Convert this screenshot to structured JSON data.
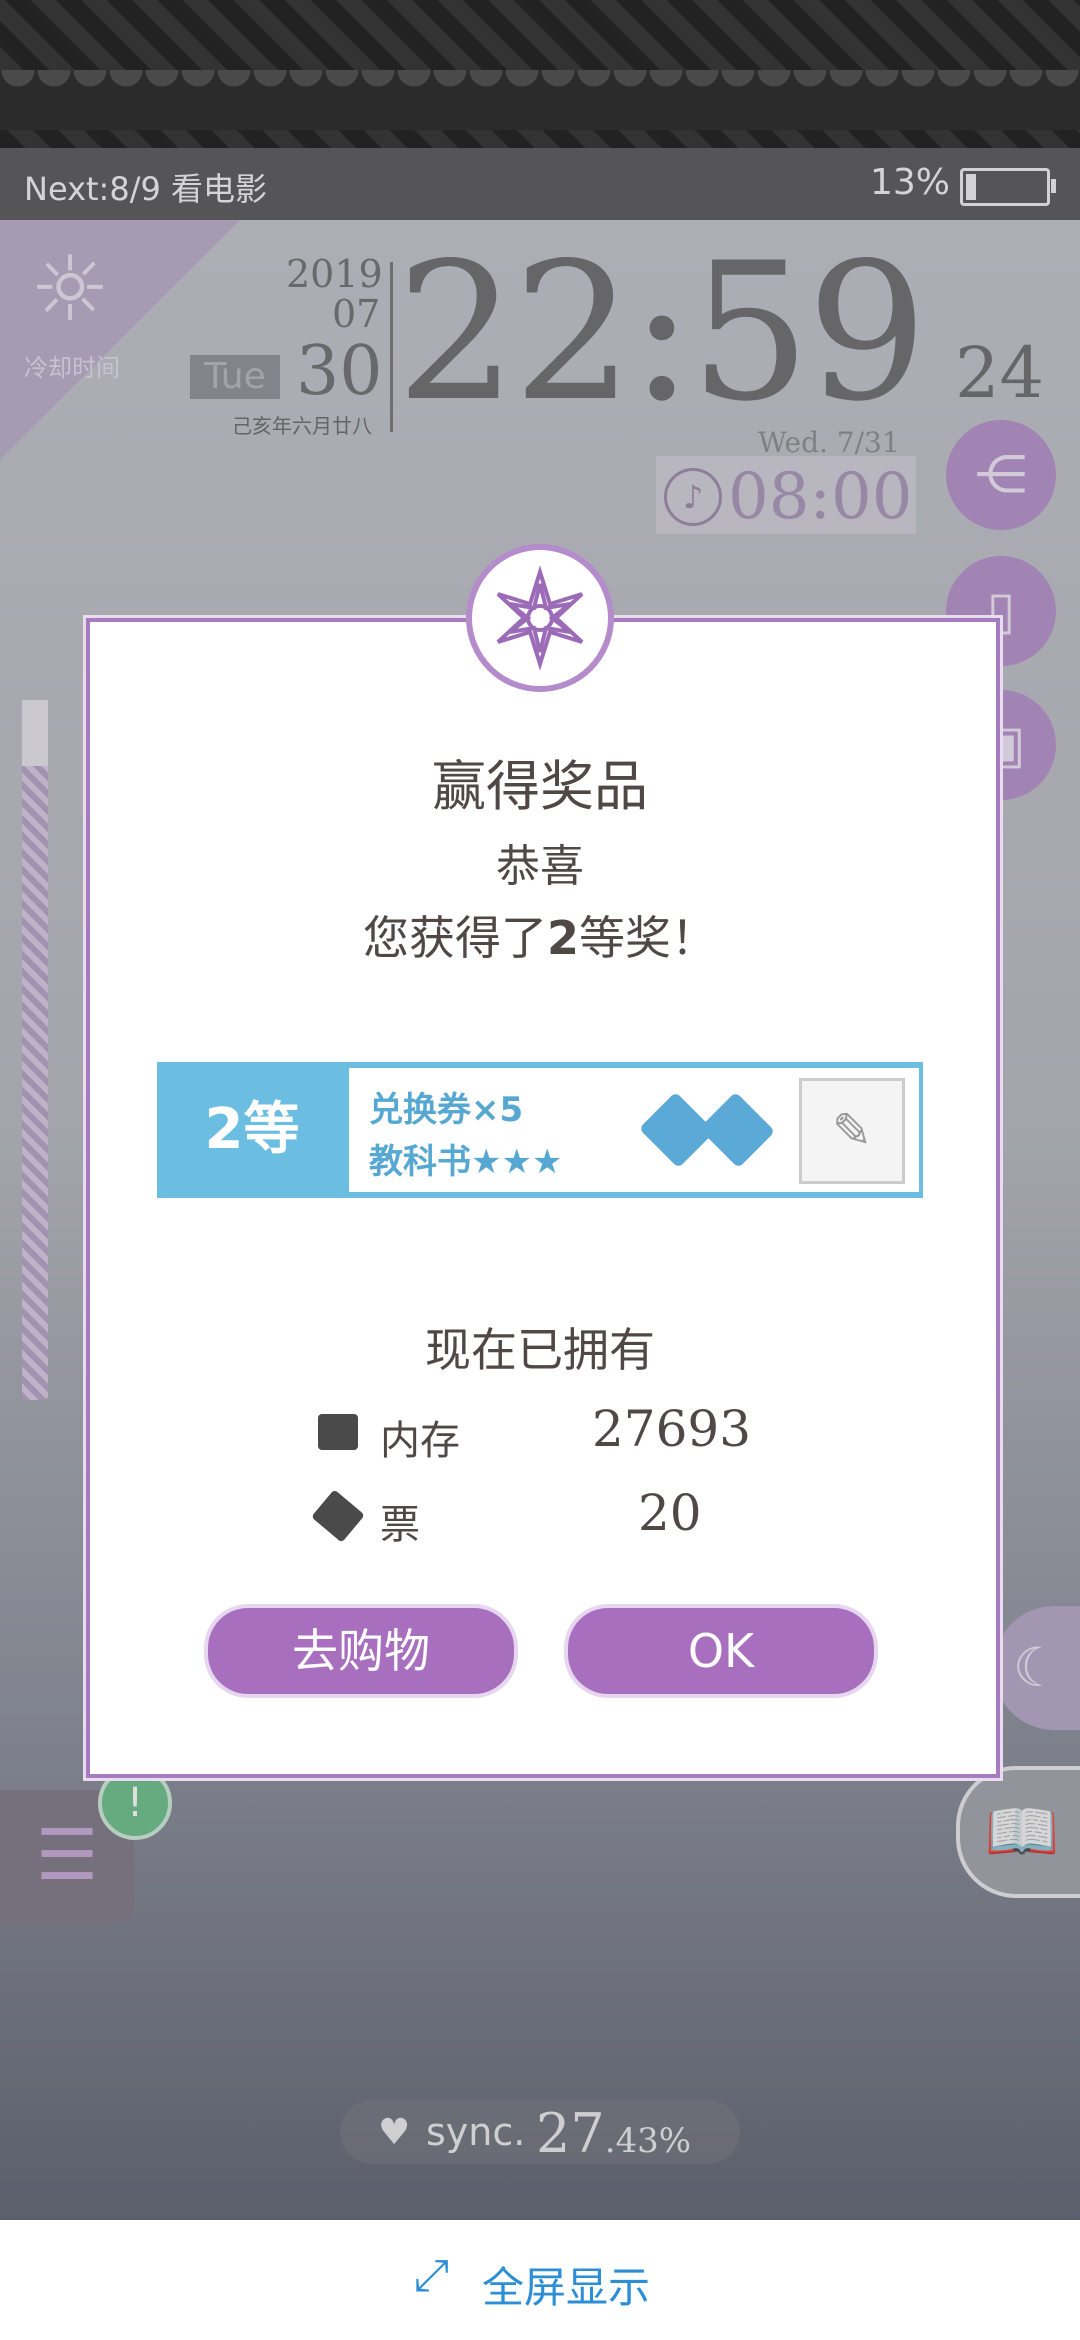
{
  "status_bar": {
    "next_event": "Next:8/9 看电影",
    "battery_pct": "13%",
    "battery_level": 0.13
  },
  "lockscreen": {
    "cooldown_label": "冷却时间",
    "year": "2019",
    "month": "07",
    "day": "30",
    "weekday": "Tue",
    "lunar_date": "己亥年六月廿八",
    "time": "22:59",
    "seconds": "24",
    "next_alarm_day": "Wed.  7/31",
    "alarm_time": "08:00",
    "sync_label": "sync.",
    "sync_int": "27",
    "sync_dec": ".43%"
  },
  "dialog": {
    "title": "赢得奖品",
    "congrats": "恭喜",
    "won_prefix": "您获得了",
    "won_rank": "2",
    "won_suffix": "等奖！",
    "prize": {
      "rank_label": "2等",
      "line1": "兑换券×5",
      "line2": "教科书★★★"
    },
    "owned_title": "现在已拥有",
    "items": [
      {
        "label": "内存",
        "value": "27693"
      },
      {
        "label": "票",
        "value": "20"
      }
    ],
    "shop_button": "去购物",
    "ok_button": "OK"
  },
  "bottom_bar": {
    "fullscreen_label": "全屏显示"
  },
  "colors": {
    "accent": "#a86fbf",
    "prize_blue": "#6bbde1",
    "link_blue": "#2c8fd6"
  }
}
